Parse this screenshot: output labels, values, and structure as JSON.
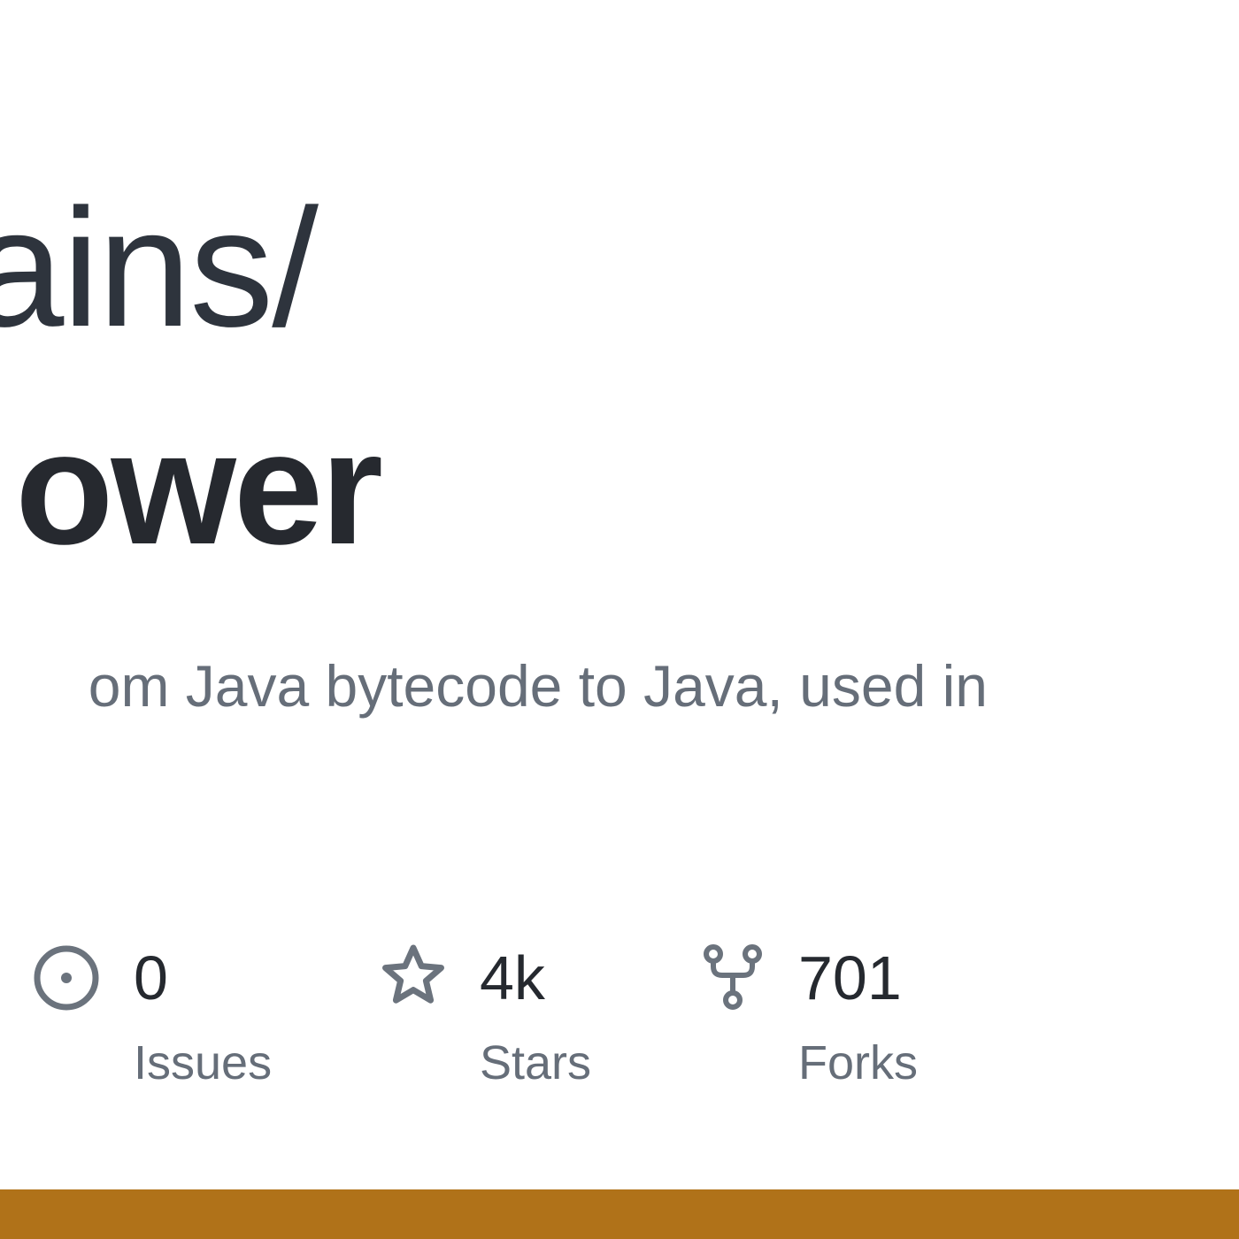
{
  "repo": {
    "owner_fragment": "ains/",
    "name_fragment": "ower",
    "description_fragment": "om Java bytecode to Java, used in"
  },
  "stats": {
    "issues": {
      "count": "0",
      "label": "Issues",
      "icon": "issue-opened-icon"
    },
    "stars": {
      "count": "4k",
      "label": "Stars",
      "icon": "star-icon"
    },
    "forks": {
      "count": "701",
      "label": "Forks",
      "icon": "repo-forked-icon"
    }
  },
  "colors": {
    "language_bar": "#b07219",
    "title": "#26292f",
    "muted": "#666e79",
    "icon": "#6b737d"
  }
}
